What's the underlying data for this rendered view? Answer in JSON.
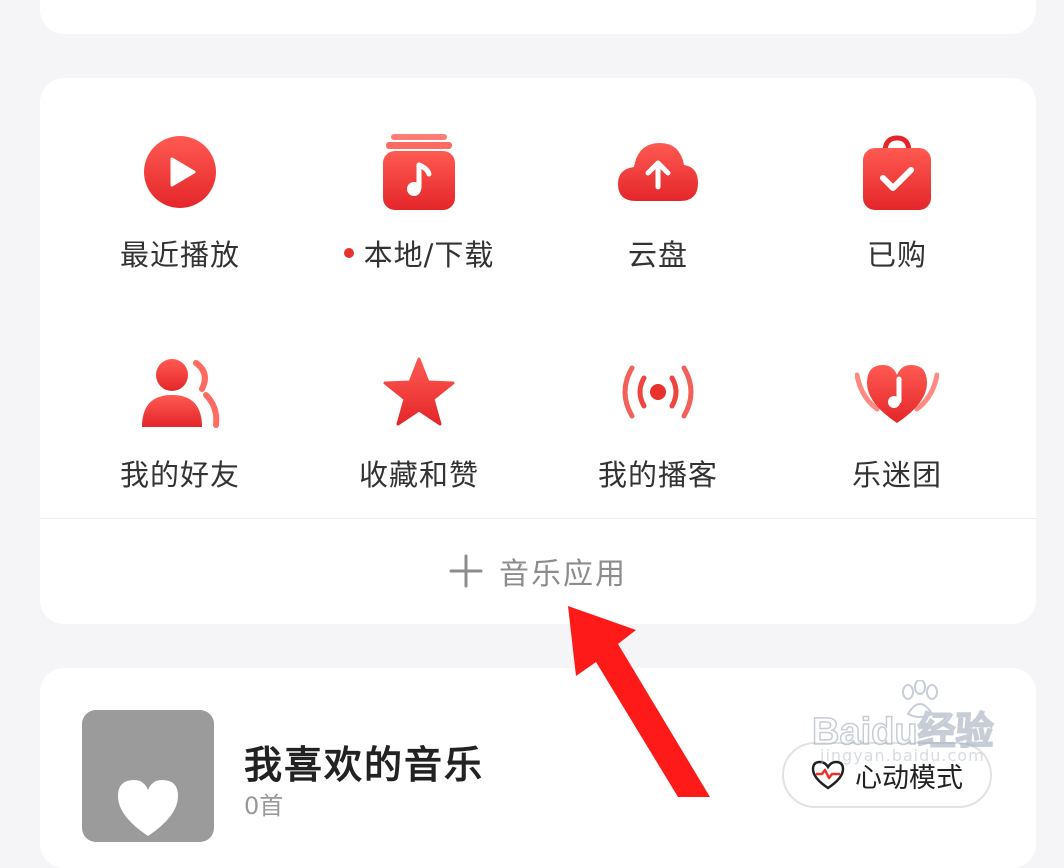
{
  "grid": {
    "items": [
      {
        "label": "最近播放",
        "icon": "play-circle-icon"
      },
      {
        "label": "本地/下载",
        "icon": "music-note-album-icon",
        "badge_dot": true
      },
      {
        "label": "云盘",
        "icon": "cloud-upload-icon"
      },
      {
        "label": "已购",
        "icon": "shopping-bag-check-icon"
      },
      {
        "label": "我的好友",
        "icon": "friends-icon"
      },
      {
        "label": "收藏和赞",
        "icon": "star-icon"
      },
      {
        "label": "我的播客",
        "icon": "broadcast-icon"
      },
      {
        "label": "乐迷团",
        "icon": "heart-note-icon"
      }
    ],
    "add_label": "音乐应用"
  },
  "favorites": {
    "title": "我喜欢的音乐",
    "subtitle": "0首",
    "mode_button": "心动模式"
  },
  "watermark": {
    "main": "Baidu经验",
    "sub": "jingyan.baidu.com"
  },
  "colors": {
    "accent": "#e8322e",
    "background": "#f5f5f7",
    "card": "#ffffff",
    "annotation_arrow": "#ff1a1a"
  }
}
